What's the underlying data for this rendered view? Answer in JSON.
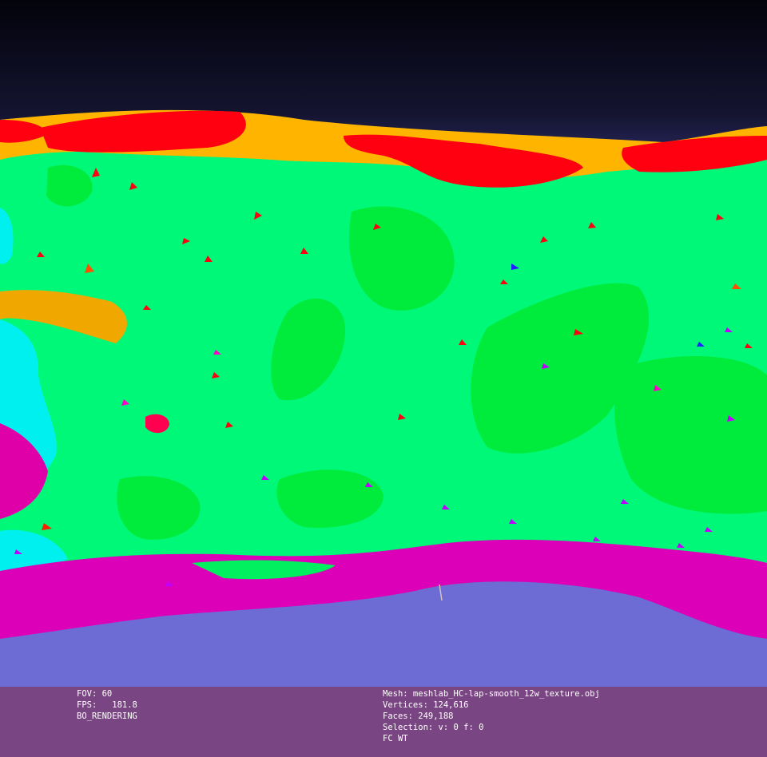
{
  "viewer": {
    "background_top": "#03030c",
    "background_bottom": "#7070d8",
    "mesh_colors": {
      "green": "#00ff7a",
      "bright_green": "#00f040",
      "red": "#ff0010",
      "orange": "#ffb000",
      "magenta": "#e000c8",
      "cyan": "#00ffff",
      "violet": "#9a30ff"
    }
  },
  "info": {
    "left": [
      "FOV: 60",
      "FPS:   181.8",
      "BO_RENDERING"
    ],
    "right": [
      "Mesh: meshlab_HC-lap-smooth_12w_texture.obj",
      "Vertices: 124,616",
      "Faces: 249,188",
      "Selection: v: 0 f: 0",
      "FC WT"
    ]
  }
}
